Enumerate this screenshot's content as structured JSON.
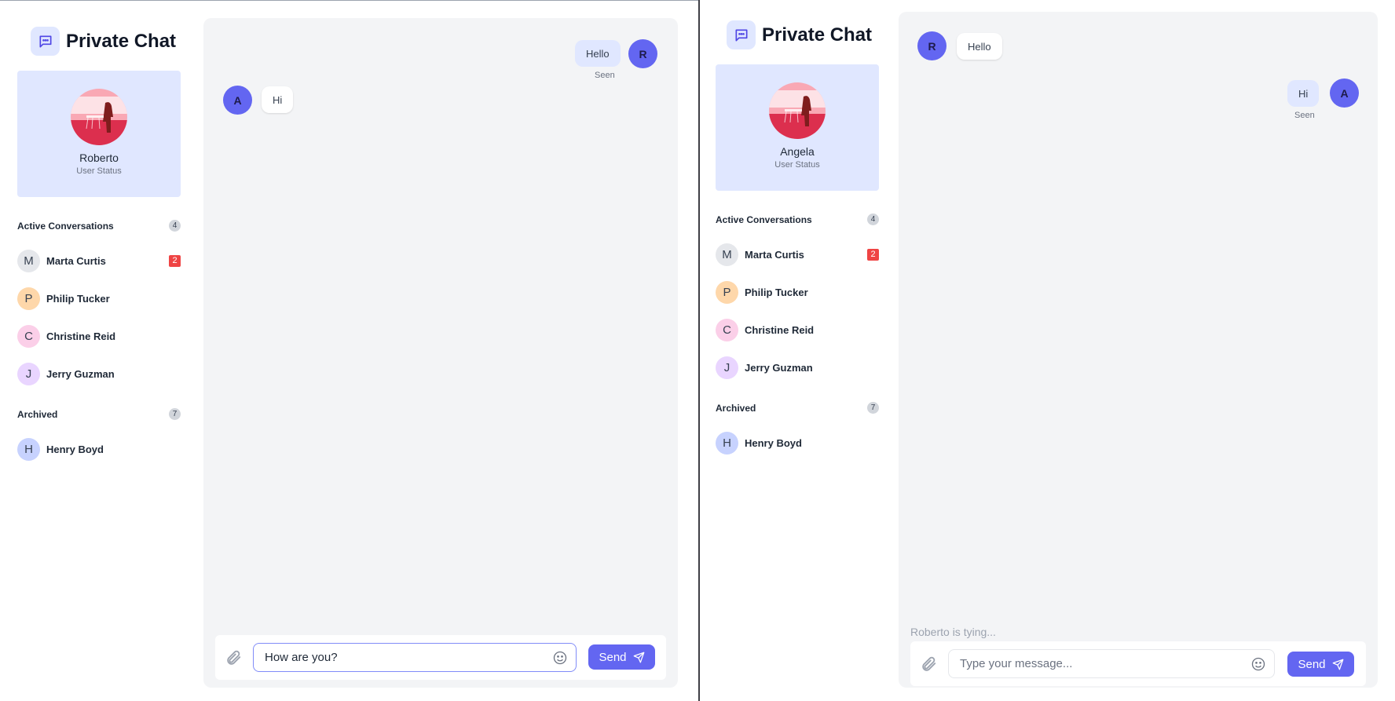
{
  "brand": {
    "title": "Private Chat",
    "icon": "chat-bubble-icon"
  },
  "sections": {
    "active_title": "Active Conversations",
    "active_count": "4",
    "archived_title": "Archived",
    "archived_count": "7"
  },
  "conversations": [
    {
      "initial": "M",
      "name": "Marta Curtis",
      "unread": "2",
      "color": "#e5e7eb"
    },
    {
      "initial": "P",
      "name": "Philip Tucker",
      "unread": "",
      "color": "#fed7aa"
    },
    {
      "initial": "C",
      "name": "Christine Reid",
      "unread": "",
      "color": "#fbcfe8"
    },
    {
      "initial": "J",
      "name": "Jerry Guzman",
      "unread": "",
      "color": "#e9d5ff"
    }
  ],
  "archived": [
    {
      "initial": "H",
      "name": "Henry Boyd",
      "color": "#c7d2fe"
    }
  ],
  "windows": {
    "left": {
      "profile": {
        "name": "Roberto",
        "status": "User Status"
      },
      "messages": [
        {
          "from": "self",
          "initial": "R",
          "text": "Hello",
          "receipt": "Seen"
        },
        {
          "from": "other",
          "initial": "A",
          "text": "Hi"
        }
      ],
      "composer": {
        "value": "How are you?",
        "placeholder": "Type your message...",
        "send_label": "Send"
      },
      "typing": ""
    },
    "right": {
      "profile": {
        "name": "Angela",
        "status": "User Status"
      },
      "messages": [
        {
          "from": "other",
          "initial": "R",
          "text": "Hello"
        },
        {
          "from": "self",
          "initial": "A",
          "text": "Hi",
          "receipt": "Seen"
        }
      ],
      "composer": {
        "value": "",
        "placeholder": "Type your message...",
        "send_label": "Send"
      },
      "typing": "Roberto is tying..."
    }
  },
  "colors": {
    "accent": "#6366f1",
    "accent_light": "#e0e7ff",
    "chat_bg": "#f3f4f6",
    "unread": "#ef4444"
  }
}
